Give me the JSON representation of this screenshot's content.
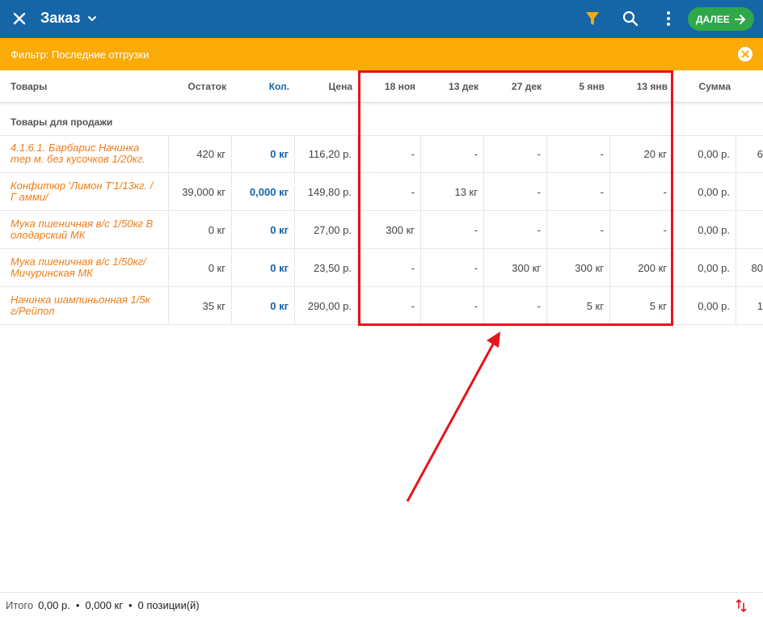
{
  "header": {
    "title": "Заказ",
    "next_label": "ДАЛЕЕ",
    "colors": {
      "bar": "#1565a7",
      "filter_icon": "#faab08",
      "next": "#2ea84a"
    }
  },
  "filter": {
    "text": "Фильтр: Последние отгрузки",
    "color": "#faab08"
  },
  "table": {
    "headers": {
      "product": "Товары",
      "stock": "Остаток",
      "qty": "Кол.",
      "price": "Цена",
      "d1": "18 ноя",
      "d2": "13 дек",
      "d3": "27 дек",
      "d4": "5 янв",
      "d5": "13 янв",
      "sum": "Сумма"
    },
    "section_title": "Товары для продажи",
    "rows": [
      {
        "name": "4.1.6.1. Барбарис Начинка тер м. без кусочков 1/20кг.",
        "stock": "420 кг",
        "qty": "0 кг",
        "price": "116,20 р.",
        "d1": "-",
        "d2": "-",
        "d3": "-",
        "d4": "-",
        "d5": "20 кг",
        "sum": "0,00 р.",
        "extra": "6"
      },
      {
        "name": "Конфитюр 'Лимон Т'1/13кг. /Г амми/",
        "stock": "39,000 кг",
        "qty": "0,000 кг",
        "price": "149,80 р.",
        "d1": "-",
        "d2": "13 кг",
        "d3": "-",
        "d4": "-",
        "d5": "-",
        "sum": "0,00 р.",
        "extra": ""
      },
      {
        "name": "Мука пшеничная в/с 1/50кг В олодарский МК",
        "stock": "0 кг",
        "qty": "0 кг",
        "price": "27,00 р.",
        "d1": "300 кг",
        "d2": "-",
        "d3": "-",
        "d4": "-",
        "d5": "-",
        "sum": "0,00 р.",
        "extra": ""
      },
      {
        "name": "Мука пшеничная в/с 1/50кг/ Мичуринская МК",
        "stock": "0 кг",
        "qty": "0 кг",
        "price": "23,50 р.",
        "d1": "-",
        "d2": "-",
        "d3": "300 кг",
        "d4": "300 кг",
        "d5": "200 кг",
        "sum": "0,00 р.",
        "extra": "80"
      },
      {
        "name": "Начинка шампиньонная 1/5к г/Рейпол",
        "stock": "35 кг",
        "qty": "0 кг",
        "price": "290,00 р.",
        "d1": "-",
        "d2": "-",
        "d3": "-",
        "d4": "5 кг",
        "d5": "5 кг",
        "sum": "0,00 р.",
        "extra": "1"
      }
    ]
  },
  "footer": {
    "label": "Итого",
    "total_sum": "0,00 р.",
    "dot": "•",
    "total_weight": "0,000 кг",
    "positions": "0 позиции(й)"
  },
  "annotation_color": "#e4141d"
}
